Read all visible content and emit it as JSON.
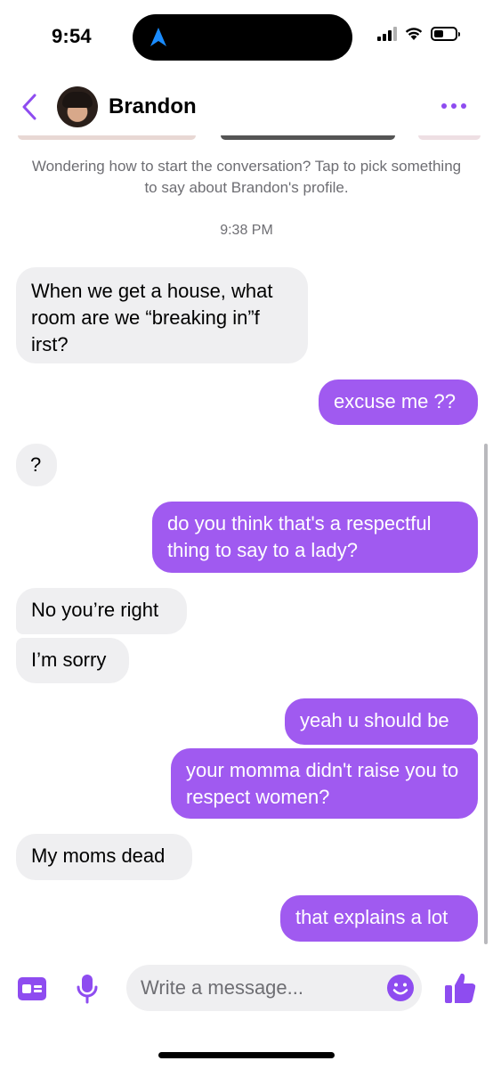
{
  "status_bar": {
    "time": "9:54"
  },
  "header": {
    "contact_name": "Brandon"
  },
  "prompt_text": "Wondering how to start the conversation? Tap to pick something to say about Brandon's profile.",
  "timestamp": "9:38 PM",
  "messages": [
    {
      "direction": "incoming",
      "text": "When we get a house, what room are we “breaking in”f irst?"
    },
    {
      "direction": "outgoing",
      "text": "excuse me ??"
    },
    {
      "direction": "incoming",
      "text": "?"
    },
    {
      "direction": "outgoing",
      "text": "do you think that's a respectful thing to say to a lady?"
    },
    {
      "direction": "incoming",
      "text": "No you’re right"
    },
    {
      "direction": "incoming",
      "text": "I’m sorry"
    },
    {
      "direction": "outgoing",
      "text": "yeah u should be"
    },
    {
      "direction": "outgoing",
      "text": "your momma didn't raise you to respect women?"
    },
    {
      "direction": "incoming",
      "text": "My moms dead"
    },
    {
      "direction": "outgoing",
      "text": "that explains a lot"
    }
  ],
  "composer": {
    "placeholder": "Write a message..."
  },
  "colors": {
    "accent": "#8e4cf0",
    "outgoing_bubble": "#a05af0",
    "incoming_bubble": "#efeff1"
  },
  "icons": [
    "location-arrow-icon",
    "signal-icon",
    "wifi-icon",
    "battery-icon",
    "back-chevron-icon",
    "more-icon",
    "profile-card-icon",
    "microphone-icon",
    "emoji-icon",
    "thumbs-up-icon"
  ]
}
